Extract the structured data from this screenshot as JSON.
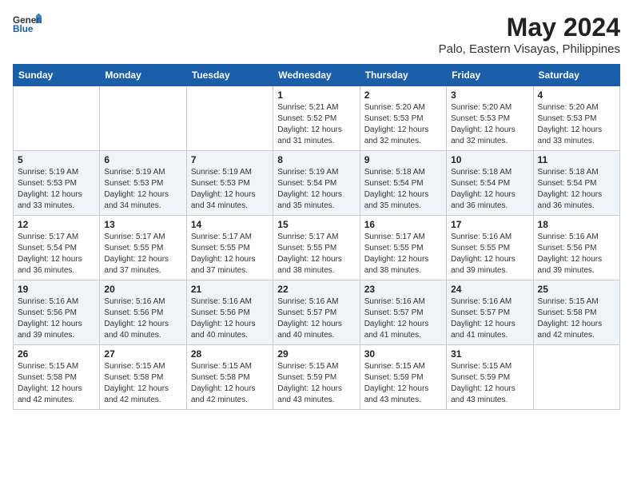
{
  "logo": {
    "text_general": "General",
    "text_blue": "Blue"
  },
  "title": "May 2024",
  "subtitle": "Palo, Eastern Visayas, Philippines",
  "weekdays": [
    "Sunday",
    "Monday",
    "Tuesday",
    "Wednesday",
    "Thursday",
    "Friday",
    "Saturday"
  ],
  "weeks": [
    [
      {
        "day": null,
        "sunrise": null,
        "sunset": null,
        "daylight": null
      },
      {
        "day": null,
        "sunrise": null,
        "sunset": null,
        "daylight": null
      },
      {
        "day": null,
        "sunrise": null,
        "sunset": null,
        "daylight": null
      },
      {
        "day": "1",
        "sunrise": "5:21 AM",
        "sunset": "5:52 PM",
        "daylight": "12 hours and 31 minutes."
      },
      {
        "day": "2",
        "sunrise": "5:20 AM",
        "sunset": "5:53 PM",
        "daylight": "12 hours and 32 minutes."
      },
      {
        "day": "3",
        "sunrise": "5:20 AM",
        "sunset": "5:53 PM",
        "daylight": "12 hours and 32 minutes."
      },
      {
        "day": "4",
        "sunrise": "5:20 AM",
        "sunset": "5:53 PM",
        "daylight": "12 hours and 33 minutes."
      }
    ],
    [
      {
        "day": "5",
        "sunrise": "5:19 AM",
        "sunset": "5:53 PM",
        "daylight": "12 hours and 33 minutes."
      },
      {
        "day": "6",
        "sunrise": "5:19 AM",
        "sunset": "5:53 PM",
        "daylight": "12 hours and 34 minutes."
      },
      {
        "day": "7",
        "sunrise": "5:19 AM",
        "sunset": "5:53 PM",
        "daylight": "12 hours and 34 minutes."
      },
      {
        "day": "8",
        "sunrise": "5:19 AM",
        "sunset": "5:54 PM",
        "daylight": "12 hours and 35 minutes."
      },
      {
        "day": "9",
        "sunrise": "5:18 AM",
        "sunset": "5:54 PM",
        "daylight": "12 hours and 35 minutes."
      },
      {
        "day": "10",
        "sunrise": "5:18 AM",
        "sunset": "5:54 PM",
        "daylight": "12 hours and 36 minutes."
      },
      {
        "day": "11",
        "sunrise": "5:18 AM",
        "sunset": "5:54 PM",
        "daylight": "12 hours and 36 minutes."
      }
    ],
    [
      {
        "day": "12",
        "sunrise": "5:17 AM",
        "sunset": "5:54 PM",
        "daylight": "12 hours and 36 minutes."
      },
      {
        "day": "13",
        "sunrise": "5:17 AM",
        "sunset": "5:55 PM",
        "daylight": "12 hours and 37 minutes."
      },
      {
        "day": "14",
        "sunrise": "5:17 AM",
        "sunset": "5:55 PM",
        "daylight": "12 hours and 37 minutes."
      },
      {
        "day": "15",
        "sunrise": "5:17 AM",
        "sunset": "5:55 PM",
        "daylight": "12 hours and 38 minutes."
      },
      {
        "day": "16",
        "sunrise": "5:17 AM",
        "sunset": "5:55 PM",
        "daylight": "12 hours and 38 minutes."
      },
      {
        "day": "17",
        "sunrise": "5:16 AM",
        "sunset": "5:55 PM",
        "daylight": "12 hours and 39 minutes."
      },
      {
        "day": "18",
        "sunrise": "5:16 AM",
        "sunset": "5:56 PM",
        "daylight": "12 hours and 39 minutes."
      }
    ],
    [
      {
        "day": "19",
        "sunrise": "5:16 AM",
        "sunset": "5:56 PM",
        "daylight": "12 hours and 39 minutes."
      },
      {
        "day": "20",
        "sunrise": "5:16 AM",
        "sunset": "5:56 PM",
        "daylight": "12 hours and 40 minutes."
      },
      {
        "day": "21",
        "sunrise": "5:16 AM",
        "sunset": "5:56 PM",
        "daylight": "12 hours and 40 minutes."
      },
      {
        "day": "22",
        "sunrise": "5:16 AM",
        "sunset": "5:57 PM",
        "daylight": "12 hours and 40 minutes."
      },
      {
        "day": "23",
        "sunrise": "5:16 AM",
        "sunset": "5:57 PM",
        "daylight": "12 hours and 41 minutes."
      },
      {
        "day": "24",
        "sunrise": "5:16 AM",
        "sunset": "5:57 PM",
        "daylight": "12 hours and 41 minutes."
      },
      {
        "day": "25",
        "sunrise": "5:15 AM",
        "sunset": "5:58 PM",
        "daylight": "12 hours and 42 minutes."
      }
    ],
    [
      {
        "day": "26",
        "sunrise": "5:15 AM",
        "sunset": "5:58 PM",
        "daylight": "12 hours and 42 minutes."
      },
      {
        "day": "27",
        "sunrise": "5:15 AM",
        "sunset": "5:58 PM",
        "daylight": "12 hours and 42 minutes."
      },
      {
        "day": "28",
        "sunrise": "5:15 AM",
        "sunset": "5:58 PM",
        "daylight": "12 hours and 42 minutes."
      },
      {
        "day": "29",
        "sunrise": "5:15 AM",
        "sunset": "5:59 PM",
        "daylight": "12 hours and 43 minutes."
      },
      {
        "day": "30",
        "sunrise": "5:15 AM",
        "sunset": "5:59 PM",
        "daylight": "12 hours and 43 minutes."
      },
      {
        "day": "31",
        "sunrise": "5:15 AM",
        "sunset": "5:59 PM",
        "daylight": "12 hours and 43 minutes."
      },
      {
        "day": null,
        "sunrise": null,
        "sunset": null,
        "daylight": null
      }
    ]
  ]
}
